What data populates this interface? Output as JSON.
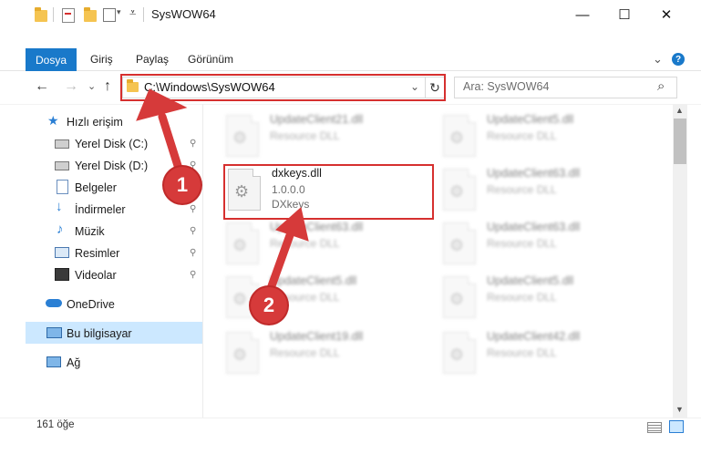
{
  "window": {
    "title": "SysWOW64",
    "minimize": "—",
    "maximize": "☐",
    "close": "✕"
  },
  "ribbon": {
    "tabs": [
      "Dosya",
      "Giriş",
      "Paylaş",
      "Görünüm"
    ],
    "collapse": "⌄",
    "help": "?"
  },
  "nav": {
    "back": "←",
    "forward": "→",
    "recent": "⌄",
    "up": "↑",
    "address": "C:\\Windows\\SysWOW64",
    "address_dropdown": "⌄",
    "refresh": "↻",
    "search_placeholder": "Ara: SysWOW64",
    "search_icon": "⌕"
  },
  "sidebar": {
    "items": [
      {
        "label": "Hızlı erişim",
        "icon": "star-icon",
        "pinned": false
      },
      {
        "label": "Yerel Disk (C:)",
        "icon": "drive-icon",
        "pinned": true
      },
      {
        "label": "Yerel Disk (D:)",
        "icon": "drive-icon",
        "pinned": true
      },
      {
        "label": "Belgeler",
        "icon": "documents-icon",
        "pinned": true
      },
      {
        "label": "İndirmeler",
        "icon": "download-icon",
        "pinned": true
      },
      {
        "label": "Müzik",
        "icon": "music-icon",
        "pinned": true
      },
      {
        "label": "Resimler",
        "icon": "pictures-icon",
        "pinned": true
      },
      {
        "label": "Videolar",
        "icon": "videos-icon",
        "pinned": true
      },
      {
        "label": "OneDrive",
        "icon": "cloud-icon",
        "pinned": false
      },
      {
        "label": "Bu bilgisayar",
        "icon": "computer-icon",
        "pinned": false,
        "selected": true
      },
      {
        "label": "Ağ",
        "icon": "network-icon",
        "pinned": false
      }
    ],
    "pin_glyph": "📌"
  },
  "files": {
    "left": [
      {
        "name": "UpdateClient21.dll",
        "line1": "Resource DLL",
        "line2": ""
      },
      {
        "name": "dxkeys.dll",
        "line1": "1.0.0.0",
        "line2": "DXkeys"
      },
      {
        "name": "UpdateClient63.dll",
        "line1": "Resource DLL",
        "line2": ""
      },
      {
        "name": "UpdateClient5.dll",
        "line1": "Resource DLL",
        "line2": ""
      },
      {
        "name": "UpdateClient19.dll",
        "line1": "Resource DLL",
        "line2": ""
      }
    ],
    "right": [
      {
        "name": "UpdateClient5.dll",
        "line1": "Resource DLL",
        "line2": ""
      },
      {
        "name": "UpdateClient63.dll",
        "line1": "Resource DLL",
        "line2": ""
      },
      {
        "name": "UpdateClient63.dll",
        "line1": "Resource DLL",
        "line2": ""
      },
      {
        "name": "UpdateClient5.dll",
        "line1": "Resource DLL",
        "line2": ""
      },
      {
        "name": "UpdateClient42.dll",
        "line1": "Resource DLL",
        "line2": ""
      }
    ]
  },
  "status": {
    "count": "161 öğe"
  },
  "callouts": {
    "one": "1",
    "two": "2",
    "color": "#d63a3a"
  }
}
